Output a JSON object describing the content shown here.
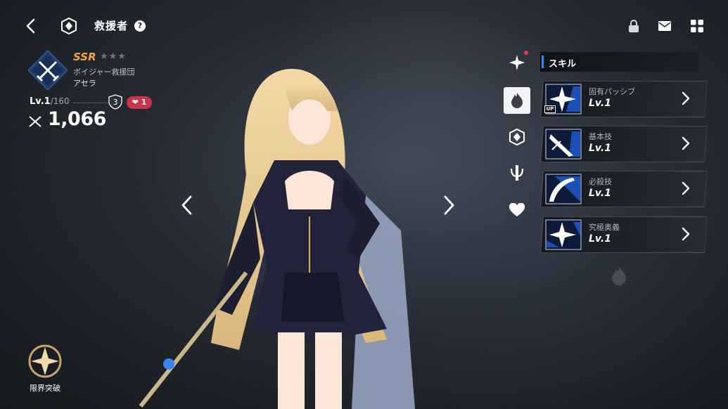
{
  "header": {
    "title": "救援者",
    "help": "?"
  },
  "character": {
    "rarity": "SSR",
    "stars": "★★★",
    "faction": "ボイジャー救援団",
    "name": "アセラ",
    "level_label": "Lv.1",
    "level_max": "/160",
    "rank": "3",
    "affinity": "1",
    "power": "1,066"
  },
  "limit_break": {
    "label": "限界突破"
  },
  "skill_panel": {
    "header": "スキル",
    "skills": [
      {
        "name": "固有パッシブ",
        "level": "Lv.1",
        "badge": "UP",
        "icon": "starburst-icon"
      },
      {
        "name": "基本技",
        "level": "Lv.1",
        "icon": "sword-slash-icon"
      },
      {
        "name": "必殺技",
        "level": "Lv.1",
        "icon": "crescent-slash-icon"
      },
      {
        "name": "究極奥義",
        "level": "Lv.1",
        "icon": "starburst-icon"
      }
    ]
  },
  "side_tabs": [
    {
      "icon": "star-burst-icon",
      "has_notification": true
    },
    {
      "icon": "flame-icon",
      "active": true
    },
    {
      "icon": "emblem-icon"
    },
    {
      "icon": "weapon-icon"
    },
    {
      "icon": "heart-hands-icon"
    }
  ],
  "colors": {
    "accent": "#3b82f6",
    "rarity": "#f2a640",
    "affinity": "#c8344a"
  }
}
